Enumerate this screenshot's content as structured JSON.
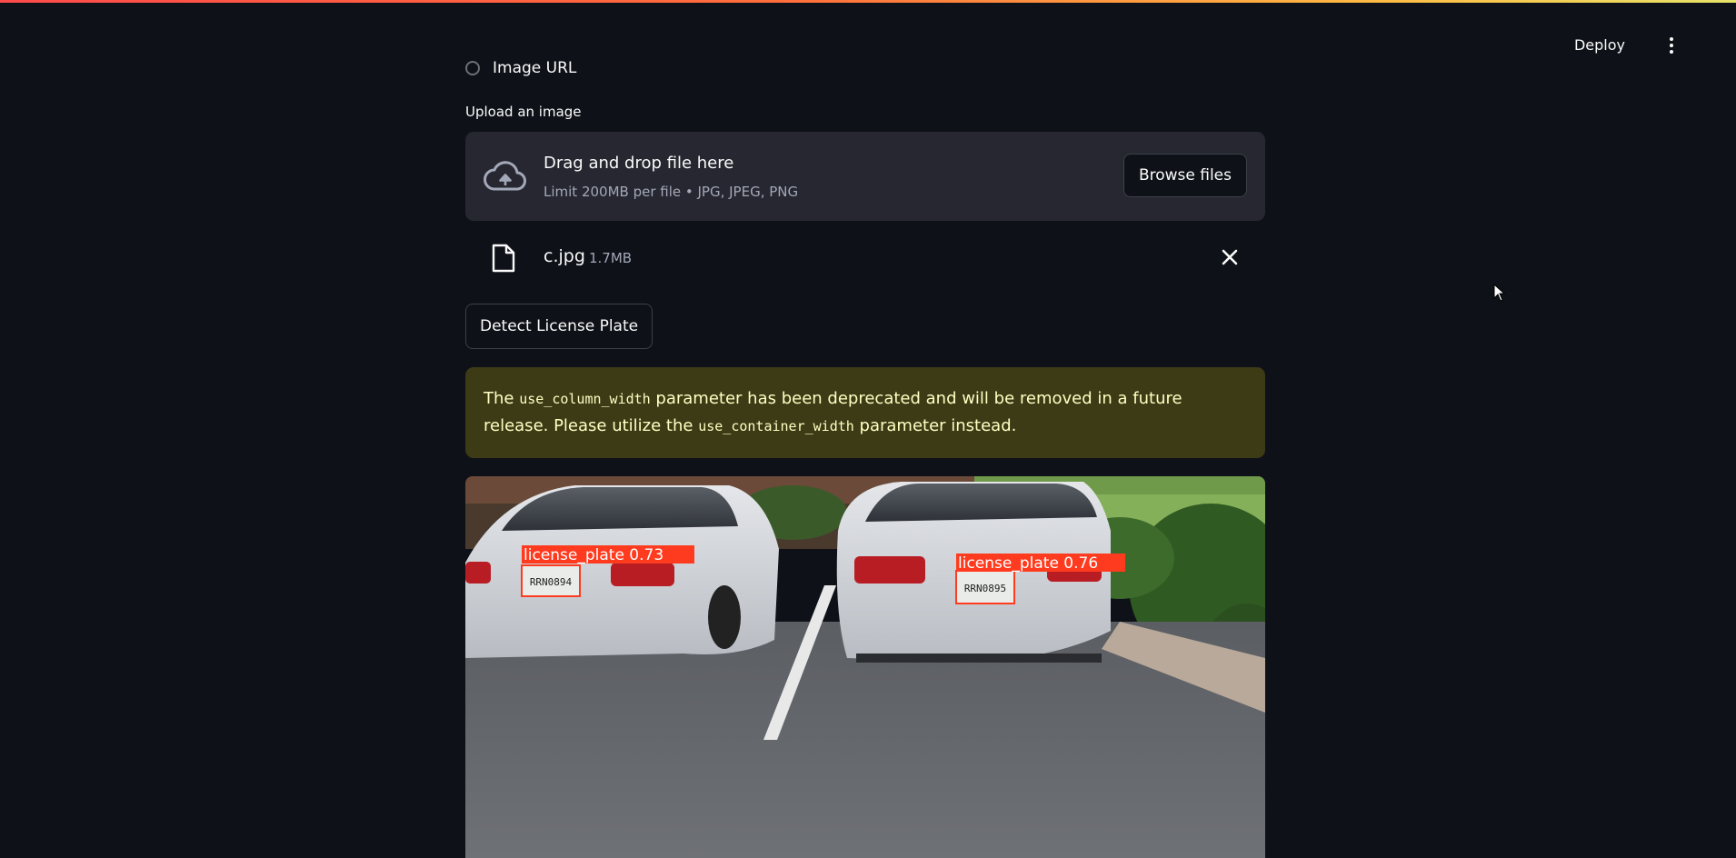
{
  "header": {
    "deploy_label": "Deploy",
    "menu_icon": "kebab-menu-icon"
  },
  "source": {
    "radio_label": "Image URL"
  },
  "uploader": {
    "label": "Upload an image",
    "drop_title": "Drag and drop file here",
    "drop_subtitle": "Limit 200MB per file • JPG, JPEG, PNG",
    "browse_label": "Browse files",
    "icon": "cloud-upload-icon"
  },
  "file": {
    "name": "c.jpg",
    "size": "1.7MB",
    "icon": "file-icon",
    "remove_icon": "close-icon"
  },
  "actions": {
    "detect_label": "Detect License Plate"
  },
  "warning": {
    "text_1": "The ",
    "code_1": "use_column_width",
    "text_2": " parameter has been deprecated and will be removed in a future release. Please utilize the ",
    "code_2": "use_container_width",
    "text_3": " parameter instead."
  },
  "result": {
    "detections": [
      {
        "label": "license_plate 0.73",
        "plate_text": "RRN0894"
      },
      {
        "label": "license_plate 0.76",
        "plate_text": "RRN0895"
      }
    ]
  },
  "colors": {
    "background": "#0e1117",
    "panel": "#262730",
    "warning_bg": "#3d3a16",
    "warning_text": "#ffffc2",
    "box_red": "#ff3b1f"
  }
}
